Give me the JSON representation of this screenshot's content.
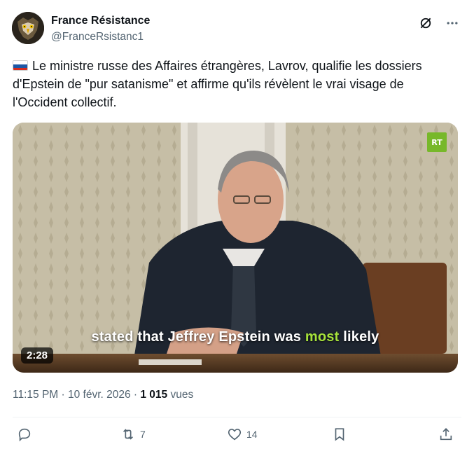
{
  "author": {
    "name": "France Résistance",
    "handle": "@FranceRsistanc1"
  },
  "tweet": {
    "text": "Le ministre russe des Affaires étrangères, Lavrov, qualifie les dossiers d'Epstein de \"pur satanisme\" et affirme qu'ils révèlent le vrai visage de l'Occident collectif.",
    "flag_colors": [
      "#ffffff",
      "#1c57a5",
      "#d52b1e"
    ]
  },
  "media": {
    "caption_before": "stated that Jeffrey Epstein was ",
    "caption_highlight": "most",
    "caption_after": " likely",
    "duration": "2:28",
    "logo": "RT",
    "highlight_color": "#a6e23b",
    "logo_color": "#77b82a"
  },
  "meta": {
    "timestamp": "11:15 PM · 10 févr. 2026 · ",
    "views_count": "1 015",
    "views_label": " vues"
  },
  "actions": {
    "reply_count": "",
    "retweet_count": "7",
    "like_count": "14"
  },
  "icons": {
    "top": [
      "grok-icon",
      "more-icon"
    ],
    "actions": [
      "reply-icon",
      "retweet-icon",
      "like-icon",
      "bookmark-icon",
      "share-icon"
    ]
  }
}
